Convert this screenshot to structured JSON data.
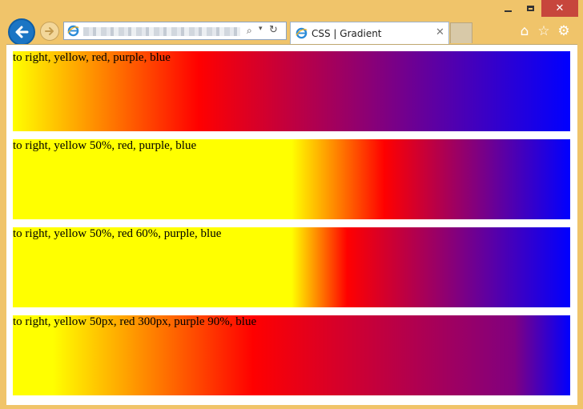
{
  "window": {
    "minimize_icon": "minimize-icon",
    "maximize_icon": "maximize-icon",
    "close_glyph": "✕"
  },
  "nav": {
    "back_icon": "back-arrow-icon",
    "forward_icon": "forward-arrow-icon"
  },
  "address_bar": {
    "url_blurred": true,
    "search_glyph": "⌕",
    "dropdown_glyph": "▾",
    "refresh_glyph": "↻"
  },
  "tab": {
    "title": "CSS | Gradient",
    "close_glyph": "✕"
  },
  "toolbar": {
    "home_glyph": "⌂",
    "favorites_glyph": "☆",
    "settings_glyph": "⚙"
  },
  "gradients": [
    {
      "label": "to right, yellow, red, purple, blue"
    },
    {
      "label": "to right, yellow 50%, red, purple, blue"
    },
    {
      "label": "to right, yellow 50%, red 60%, purple, blue"
    },
    {
      "label": "to right, yellow 50px, red 300px, purple 90%, blue"
    }
  ],
  "colors": {
    "frame": "#f0c46a",
    "close_button": "#c7463c",
    "back_button": "#1b75c4"
  }
}
